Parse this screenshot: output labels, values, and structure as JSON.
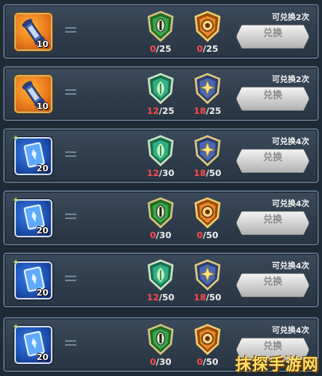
{
  "rows": [
    {
      "item": {
        "type": "scroll-icon",
        "quantity": "10",
        "color": "orange"
      },
      "costs": [
        {
          "icon": "green-eye-badge-icon",
          "have": "0",
          "need": "25"
        },
        {
          "icon": "orange-eye-badge-icon",
          "have": "0",
          "need": "25"
        }
      ],
      "times": "可兑换2次",
      "button": "兑换"
    },
    {
      "item": {
        "type": "scroll-icon",
        "quantity": "10",
        "color": "orange"
      },
      "costs": [
        {
          "icon": "green-leaf-badge-icon",
          "have": "12",
          "need": "25"
        },
        {
          "icon": "blue-star-badge-icon",
          "have": "18",
          "need": "25"
        }
      ],
      "times": "可兑换2次",
      "button": "兑换"
    },
    {
      "item": {
        "type": "card-icon",
        "quantity": "20",
        "color": "blue"
      },
      "costs": [
        {
          "icon": "green-leaf-badge-icon",
          "have": "12",
          "need": "30"
        },
        {
          "icon": "blue-star-badge-icon",
          "have": "18",
          "need": "50"
        }
      ],
      "times": "可兑换4次",
      "button": "兑换"
    },
    {
      "item": {
        "type": "card-icon",
        "quantity": "20",
        "color": "blue"
      },
      "costs": [
        {
          "icon": "green-eye-badge-icon",
          "have": "0",
          "need": "30"
        },
        {
          "icon": "orange-eye-badge-icon",
          "have": "0",
          "need": "50"
        }
      ],
      "times": "可兑换4次",
      "button": "兑换"
    },
    {
      "item": {
        "type": "card-icon",
        "quantity": "20",
        "color": "blue"
      },
      "costs": [
        {
          "icon": "green-leaf-badge-icon",
          "have": "12",
          "need": "50"
        },
        {
          "icon": "blue-star-badge-icon",
          "have": "18",
          "need": "50"
        }
      ],
      "times": "可兑换4次",
      "button": "兑换"
    },
    {
      "item": {
        "type": "card-icon",
        "quantity": "20",
        "color": "blue"
      },
      "costs": [
        {
          "icon": "green-eye-badge-icon",
          "have": "0",
          "need": "30"
        },
        {
          "icon": "orange-eye-badge-icon",
          "have": "0",
          "need": "50"
        }
      ],
      "times": "可兑换4次",
      "button": "兑换"
    }
  ],
  "watermark": "抹探手游网"
}
